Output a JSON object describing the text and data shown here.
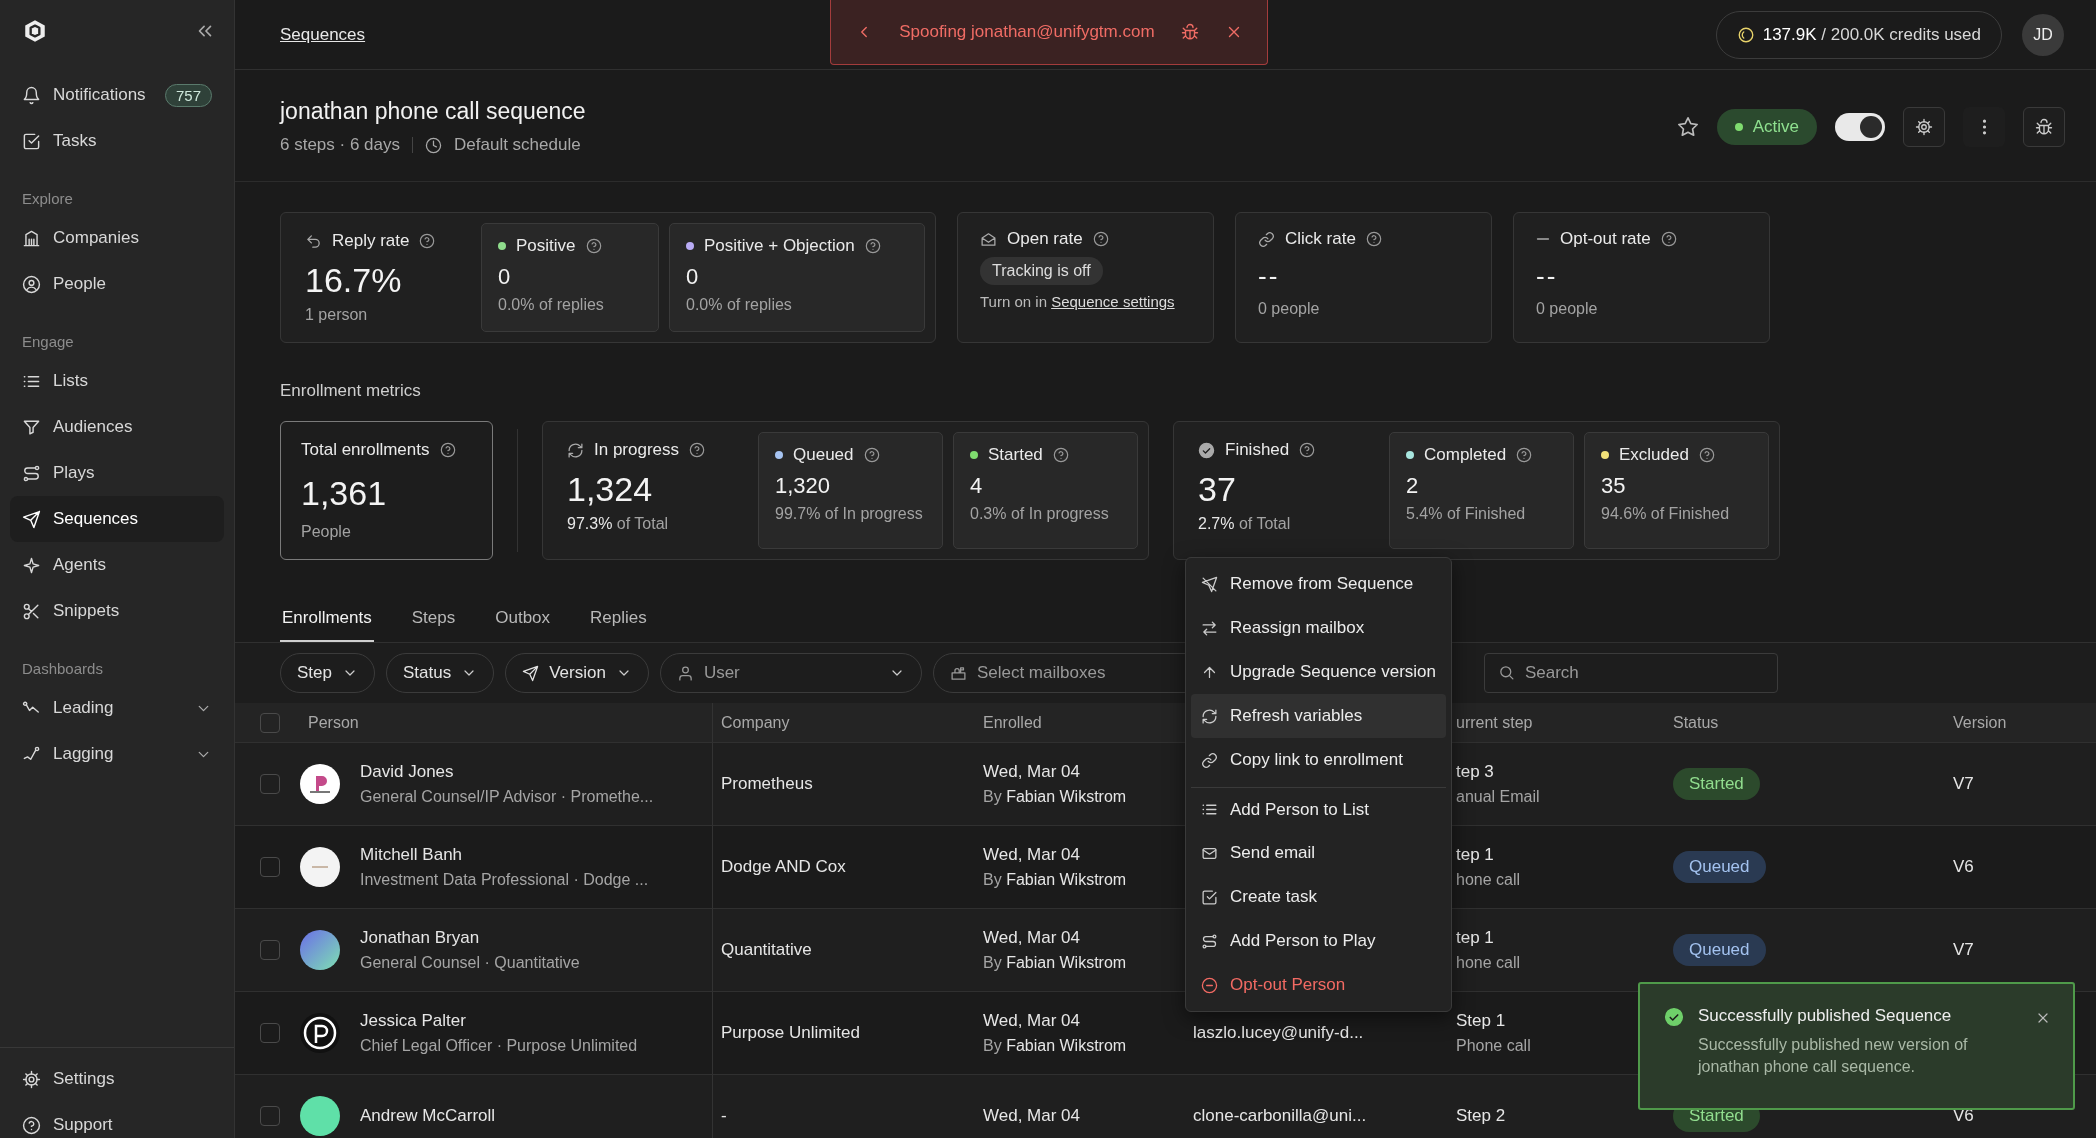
{
  "sidebar": {
    "top_items": [
      {
        "label": "Notifications",
        "badge": "757",
        "selected": false
      },
      {
        "label": "Tasks",
        "selected": false
      }
    ],
    "sections": [
      {
        "heading": "Explore",
        "items": [
          {
            "label": "Companies",
            "selected": false
          },
          {
            "label": "People",
            "selected": false
          }
        ]
      },
      {
        "heading": "Engage",
        "items": [
          {
            "label": "Lists",
            "selected": false
          },
          {
            "label": "Audiences",
            "selected": false
          },
          {
            "label": "Plays",
            "selected": false
          },
          {
            "label": "Sequences",
            "selected": true
          },
          {
            "label": "Agents",
            "selected": false
          },
          {
            "label": "Snippets",
            "selected": false
          }
        ]
      },
      {
        "heading": "Dashboards",
        "items": [
          {
            "label": "Leading",
            "selected": false,
            "expanded": false
          },
          {
            "label": "Lagging",
            "selected": false,
            "expanded": false
          }
        ]
      }
    ],
    "bottom_items": [
      {
        "label": "Settings",
        "selected": false
      },
      {
        "label": "Support",
        "selected": false
      }
    ]
  },
  "breadcrumb": "Sequences",
  "spoof_banner": {
    "text": "Spoofing jonathan@unifygtm.com"
  },
  "credits": "**137.9K** / 200.0K credits used",
  "user_avatar": "JD",
  "sequence": {
    "title": "jonathan phone call sequence",
    "meta": "6 steps · 6 days",
    "schedule": "Default schedule",
    "starred": false,
    "status": "Active",
    "enabled": true
  },
  "reply_metrics": [
    {
      "kind": "group",
      "label": "Reply rate",
      "value": "16.7%",
      "sub": "1 person",
      "children": [
        {
          "label": "Positive",
          "color": "#8fdc8c",
          "value": "0",
          "sub": "0.0% of replies"
        },
        {
          "label": "Positive + Objection",
          "color": "#b9acf5",
          "value": "0",
          "sub": "0.0% of replies"
        }
      ]
    },
    {
      "kind": "tracking",
      "label": "Open rate",
      "tag": "Tracking is off",
      "note": "Turn on in",
      "link": "Sequence settings"
    },
    {
      "kind": "single",
      "label": "Click rate",
      "value": "--",
      "sub": "0 people"
    },
    {
      "kind": "single",
      "label": "Opt-out rate",
      "value": "--",
      "sub": "0 people"
    }
  ],
  "enrollment_metrics": {
    "title": "Enrollment metrics",
    "groups": [
      {
        "kind": "single",
        "label": "Total enrollments",
        "value": "1,361",
        "sub": "People"
      },
      {
        "kind": "group",
        "label": "In progress",
        "value": "1,324",
        "sub": "**97.3%** of Total",
        "children": [
          {
            "label": "Queued",
            "color": "#a7c4f2",
            "value": "1,320",
            "sub": "99.7% of In progress"
          },
          {
            "label": "Started",
            "color": "#7fdc6f",
            "value": "4",
            "sub": "0.3% of In progress"
          }
        ]
      },
      {
        "kind": "group",
        "label": "Finished",
        "value": "37",
        "sub": "**2.7%** of Total",
        "children": [
          {
            "label": "Completed",
            "color": "#a8e6df",
            "value": "2",
            "sub": "5.4% of Finished"
          },
          {
            "label": "Excluded",
            "color": "#f2e27a",
            "value": "35",
            "sub": "94.6% of Finished"
          }
        ]
      }
    ]
  },
  "tabs": [
    {
      "label": "Enrollments",
      "selected": true
    },
    {
      "label": "Steps",
      "selected": false
    },
    {
      "label": "Outbox",
      "selected": false
    },
    {
      "label": "Replies",
      "selected": false
    }
  ],
  "filters": [
    {
      "kind": "select",
      "label": "Step"
    },
    {
      "kind": "select",
      "label": "Status"
    },
    {
      "kind": "select",
      "label": "Version"
    },
    {
      "kind": "user",
      "placeholder": "User"
    },
    {
      "kind": "mailbox",
      "placeholder": "Select mailboxes"
    }
  ],
  "search": {
    "placeholder": "Search"
  },
  "table": {
    "all_checked": false,
    "columns": [
      "Person",
      "Company",
      "Enrolled",
      "urrent step",
      "Status",
      "Version"
    ],
    "rows": [
      {
        "checked": false,
        "name": "David Jones",
        "title": "General Counsel/IP Advisor · Promethe...",
        "company": "Prometheus",
        "enrolled": "Wed, Mar 04",
        "enrolled_by": "By **Fabian Wikstrom**",
        "step": "tep 3",
        "step_type": "anual Email",
        "status": {
          "kind": "started",
          "label": "Started"
        },
        "version": "V7"
      },
      {
        "checked": false,
        "name": "Mitchell Banh",
        "title": "Investment Data Professional · Dodge ...",
        "company": "Dodge AND Cox",
        "enrolled": "Wed, Mar 04",
        "enrolled_by": "By **Fabian Wikstrom**",
        "step": "tep 1",
        "step_type": "hone call",
        "status": {
          "kind": "queued",
          "label": "Queued"
        },
        "version": "V6"
      },
      {
        "checked": false,
        "name": "Jonathan Bryan",
        "title": "General Counsel · Quantitative",
        "company": "Quantitative",
        "enrolled": "Wed, Mar 04",
        "enrolled_by": "By **Fabian Wikstrom**",
        "step": "tep 1",
        "step_type": "hone call",
        "status": {
          "kind": "queued",
          "label": "Queued"
        },
        "version": "V7"
      },
      {
        "checked": false,
        "name": "Jessica Palter",
        "title": "Chief Legal Officer · Purpose Unlimited",
        "company": "Purpose Unlimited",
        "enrolled": "Wed, Mar 04",
        "enrolled_by": "By **Fabian Wikstrom**",
        "mailbox": "laszlo.lucey@unify-d...",
        "step": "Step 1",
        "step_type": "Phone call"
      },
      {
        "checked": false,
        "name": "Andrew McCarroll",
        "company": "-",
        "enrolled": "Wed, Mar 04",
        "mailbox": "clone-carbonilla@uni...",
        "step": "Step 2",
        "status": {
          "kind": "started",
          "label": "Started"
        },
        "version": "V6"
      }
    ]
  },
  "context_menu": [
    {
      "label": "Remove from Sequence",
      "kind": "normal",
      "selected": false
    },
    {
      "label": "Reassign mailbox",
      "kind": "normal",
      "selected": false
    },
    {
      "label": "Upgrade Sequence version",
      "kind": "normal",
      "selected": false
    },
    {
      "label": "Refresh variables",
      "kind": "normal",
      "selected": true
    },
    {
      "label": "Copy link to enrollment",
      "kind": "normal",
      "selected": false
    },
    {
      "label": "Add Person to List",
      "kind": "normal",
      "selected": false,
      "divider_before": true
    },
    {
      "label": "Send email",
      "kind": "normal",
      "selected": false
    },
    {
      "label": "Create task",
      "kind": "normal",
      "selected": false
    },
    {
      "label": "Add Person to Play",
      "kind": "normal",
      "selected": false
    },
    {
      "label": "Opt-out Person",
      "kind": "danger",
      "selected": false
    }
  ],
  "toast": {
    "title": "Successfully published Sequence",
    "message": "Successfully published new version of jonathan phone call sequence."
  }
}
